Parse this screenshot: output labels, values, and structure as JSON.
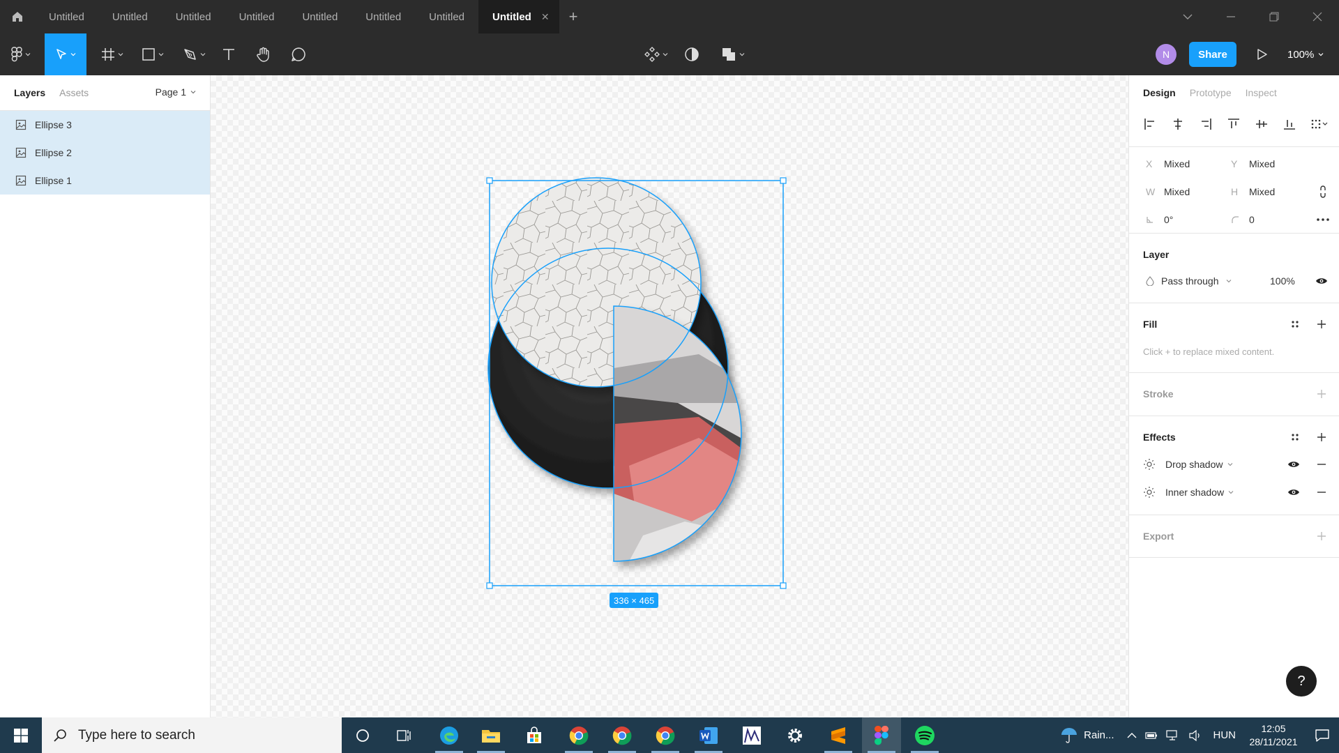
{
  "titlebar": {
    "tabs": [
      "Untitled",
      "Untitled",
      "Untitled",
      "Untitled",
      "Untitled",
      "Untitled",
      "Untitled"
    ],
    "active_tab": "Untitled",
    "icons": {
      "home": "home-icon",
      "close_tab": "close-icon",
      "add_tab": "plus-icon"
    }
  },
  "toolbar": {
    "share_label": "Share",
    "avatar_initial": "N",
    "zoom": "100%",
    "accent": "#18a0fb"
  },
  "left_panel": {
    "tabs": {
      "layers": "Layers",
      "assets": "Assets"
    },
    "page": "Page 1",
    "layers": [
      {
        "name": "Ellipse 3",
        "selected": true
      },
      {
        "name": "Ellipse 2",
        "selected": true
      },
      {
        "name": "Ellipse 1",
        "selected": true
      }
    ]
  },
  "canvas": {
    "selection_size": "336 × 465"
  },
  "right_panel": {
    "tabs": {
      "design": "Design",
      "prototype": "Prototype",
      "inspect": "Inspect"
    },
    "props": {
      "x_label": "X",
      "x_value": "Mixed",
      "y_label": "Y",
      "y_value": "Mixed",
      "w_label": "W",
      "w_value": "Mixed",
      "h_label": "H",
      "h_value": "Mixed",
      "rotation": "0°",
      "radius": "0"
    },
    "layer": {
      "title": "Layer",
      "blend": "Pass through",
      "opacity": "100%"
    },
    "fill": {
      "title": "Fill",
      "hint": "Click + to replace mixed content."
    },
    "stroke": {
      "title": "Stroke"
    },
    "effects": {
      "title": "Effects",
      "items": [
        "Drop shadow",
        "Inner shadow"
      ]
    },
    "export": {
      "title": "Export"
    },
    "help": "?"
  },
  "taskbar": {
    "search_placeholder": "Type here to search",
    "weather": "Rain...",
    "language": "HUN",
    "time": "12:05",
    "date": "28/11/2021"
  }
}
